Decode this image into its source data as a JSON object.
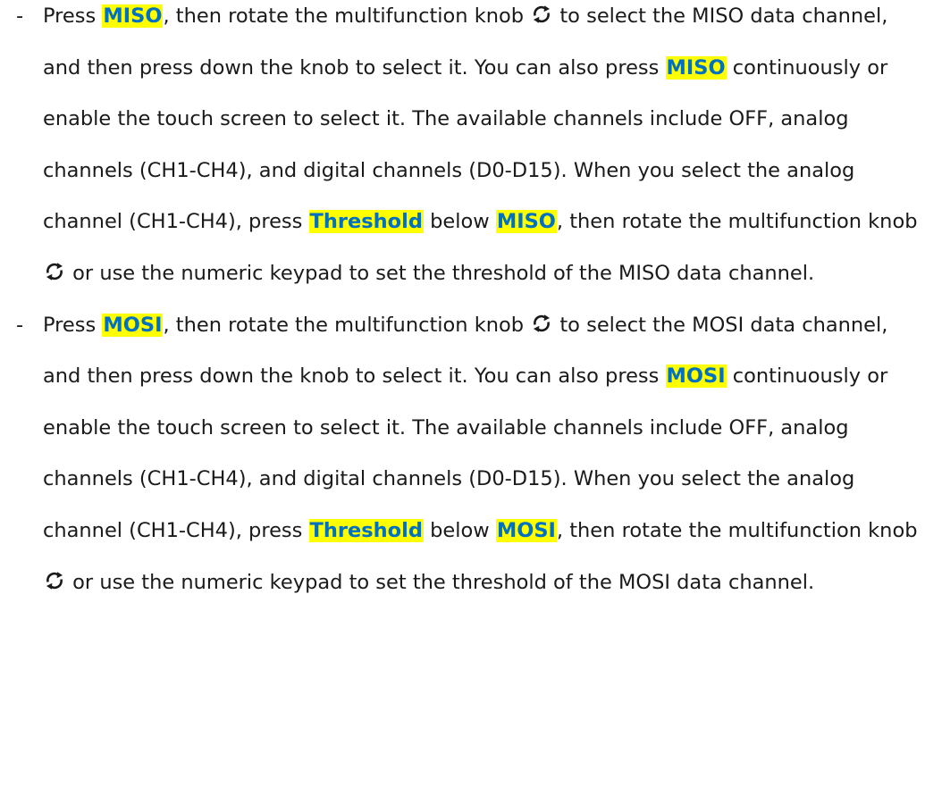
{
  "bullet_char": "-",
  "items": [
    {
      "s0": "Press ",
      "k0": "MISO",
      "s1": ", then rotate the multifunction knob ",
      "s2": " to select the MISO data channel, and then press down the knob to select it. You can also press ",
      "k1": "MISO",
      "s3": " continuously or enable the touch screen to select it. The available channels include OFF, analog channels (CH1-CH4), and digital channels (D0-D15). When you select the analog channel (CH1-CH4), press ",
      "k2": "Threshold",
      "s4": " below ",
      "k3": "MISO",
      "s5": ", then rotate the multifunction knob ",
      "s6": " or use the numeric keypad to set the threshold of the MISO data channel."
    },
    {
      "s0": "Press ",
      "k0": "MOSI",
      "s1": ", then rotate the multifunction knob ",
      "s2": " to select the MOSI data channel, and then press down the knob to select it. You can also press ",
      "k1": "MOSI",
      "s3": " continuously or enable the touch screen to select it. The available channels include OFF, analog channels (CH1-CH4), and digital channels (D0-D15). When you select the analog channel (CH1-CH4), press ",
      "k2": "Threshold",
      "s4": " below ",
      "k3": "MOSI",
      "s5": ", then rotate the multifunction knob ",
      "s6": " or use the numeric keypad to set the threshold of the MOSI data channel."
    }
  ],
  "icon": "multifunction-knob-rotate-icon",
  "colors": {
    "highlight": "#ffff00",
    "keyword_text": "#0070c0",
    "body_text": "#1a1a1a"
  }
}
